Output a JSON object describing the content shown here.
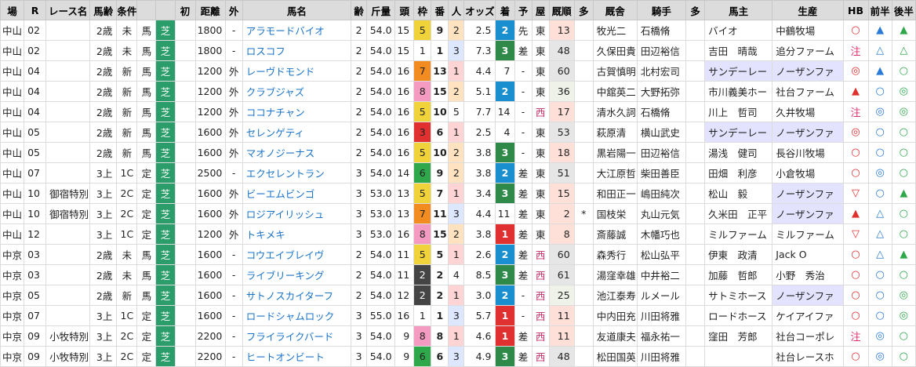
{
  "headers": [
    "場",
    "R",
    "レース名",
    "馬齢",
    "条件",
    "",
    "初",
    "距離",
    "外",
    "馬名",
    "齢",
    "斤量",
    "頭",
    "枠",
    "番",
    "人",
    "オッズ",
    "着",
    "予",
    "屋",
    "厩順",
    "多",
    "厩舎",
    "騎手",
    "多",
    "馬主",
    "生産",
    "HB",
    "前半",
    "後半"
  ],
  "rows": [
    [
      "中山",
      "02",
      "",
      "2歳",
      "未",
      "馬",
      "芝",
      "",
      "1800",
      "-",
      "アラモードバイオ",
      "2",
      "54.0",
      "15",
      "5",
      "9",
      "2",
      "2.5",
      "2",
      "先",
      "東",
      "13",
      "",
      "牧光二",
      "石橋脩",
      "",
      "バイオ",
      "中鶴牧場",
      "○",
      "▲",
      "▲"
    ],
    [
      "中山",
      "02",
      "",
      "2歳",
      "未",
      "馬",
      "芝",
      "",
      "1800",
      "-",
      "ロスコフ",
      "2",
      "54.0",
      "15",
      "1",
      "1",
      "3",
      "7.3",
      "3",
      "差",
      "東",
      "48",
      "",
      "久保田貴",
      "田辺裕信",
      "",
      "吉田　晴哉",
      "追分ファーム",
      "注",
      "△",
      "△"
    ],
    [
      "中山",
      "04",
      "",
      "2歳",
      "新",
      "馬",
      "芝",
      "",
      "1200",
      "外",
      "レーヴドモンド",
      "2",
      "54.0",
      "16",
      "7",
      "13",
      "1",
      "4.4",
      "7",
      "-",
      "東",
      "60",
      "",
      "古賀慎明",
      "北村宏司",
      "",
      "サンデーレー",
      "ノーザンファ",
      "◎",
      "▲",
      "○"
    ],
    [
      "中山",
      "04",
      "",
      "2歳",
      "新",
      "馬",
      "芝",
      "",
      "1200",
      "外",
      "クラブジャズ",
      "2",
      "54.0",
      "16",
      "8",
      "15",
      "2",
      "5.1",
      "2",
      "-",
      "東",
      "36",
      "",
      "中舘英二",
      "大野拓弥",
      "",
      "市川義美ホー",
      "社台ファーム",
      "▲",
      "○",
      "◎"
    ],
    [
      "中山",
      "04",
      "",
      "2歳",
      "新",
      "馬",
      "芝",
      "",
      "1200",
      "外",
      "ココナチャン",
      "2",
      "54.0",
      "16",
      "5",
      "10",
      "5",
      "7.7",
      "14",
      "-",
      "西",
      "17",
      "",
      "清水久詞",
      "石橋脩",
      "",
      "川上　哲司",
      "久井牧場",
      "注",
      "◎",
      "◎"
    ],
    [
      "中山",
      "05",
      "",
      "2歳",
      "新",
      "馬",
      "芝",
      "",
      "1600",
      "外",
      "セレンゲティ",
      "2",
      "54.0",
      "16",
      "3",
      "6",
      "1",
      "2.5",
      "4",
      "-",
      "東",
      "53",
      "",
      "萩原清",
      "横山武史",
      "",
      "サンデーレー",
      "ノーザンファ",
      "◎",
      "○",
      "○"
    ],
    [
      "中山",
      "05",
      "",
      "2歳",
      "新",
      "馬",
      "芝",
      "",
      "1600",
      "外",
      "マオノジーナス",
      "2",
      "54.0",
      "16",
      "5",
      "10",
      "2",
      "3.8",
      "3",
      "-",
      "東",
      "18",
      "",
      "黒岩陽一",
      "田辺裕信",
      "",
      "湯浅　健司",
      "長谷川牧場",
      "○",
      "○",
      "○"
    ],
    [
      "中山",
      "07",
      "",
      "3上",
      "1C",
      "定",
      "芝",
      "",
      "2500",
      "-",
      "エクセレントラン",
      "3",
      "54.0",
      "14",
      "6",
      "9",
      "2",
      "3.8",
      "2",
      "差",
      "東",
      "51",
      "",
      "大江原哲",
      "柴田善臣",
      "",
      "田畑　利彦",
      "小倉牧場",
      "○",
      "◎",
      "○"
    ],
    [
      "中山",
      "10",
      "御宿特別",
      "3上",
      "2C",
      "定",
      "芝",
      "",
      "1600",
      "外",
      "ビーエムビンゴ",
      "3",
      "53.0",
      "13",
      "5",
      "7",
      "1",
      "3.4",
      "3",
      "差",
      "東",
      "15",
      "",
      "和田正一",
      "嶋田純次",
      "",
      "松山　毅",
      "ノーザンファ",
      "▽",
      "○",
      "▲"
    ],
    [
      "中山",
      "10",
      "御宿特別",
      "3上",
      "2C",
      "定",
      "芝",
      "",
      "1600",
      "外",
      "ロジアイリッシュ",
      "3",
      "53.0",
      "13",
      "7",
      "11",
      "3",
      "4.4",
      "11",
      "差",
      "東",
      "2",
      "*",
      "国枝栄",
      "丸山元気",
      "",
      "久米田　正平",
      "ノーザンファ",
      "▲",
      "△",
      "○"
    ],
    [
      "中山",
      "12",
      "",
      "3上",
      "1C",
      "定",
      "芝",
      "",
      "1200",
      "外",
      "トキメキ",
      "3",
      "53.0",
      "16",
      "8",
      "15",
      "2",
      "3.8",
      "1",
      "差",
      "東",
      "8",
      "",
      "斎藤誠",
      "木幡巧也",
      "",
      "ミルファーム",
      "ミルファーム",
      "▽",
      "△",
      "○"
    ],
    [
      "中京",
      "03",
      "",
      "2歳",
      "未",
      "馬",
      "芝",
      "",
      "1600",
      "-",
      "コウエイブレイヴ",
      "2",
      "54.0",
      "11",
      "5",
      "5",
      "1",
      "2.6",
      "2",
      "差",
      "西",
      "60",
      "",
      "森秀行",
      "松山弘平",
      "",
      "伊東　政清",
      "Jack O",
      "○",
      "△",
      "▲"
    ],
    [
      "中京",
      "03",
      "",
      "2歳",
      "未",
      "馬",
      "芝",
      "",
      "1600",
      "-",
      "ライブリーキング",
      "2",
      "54.0",
      "11",
      "2",
      "2",
      "4",
      "8.5",
      "3",
      "差",
      "西",
      "61",
      "",
      "湯窪幸雄",
      "中井裕二",
      "",
      "加藤　哲郎",
      "小野　秀治",
      "○",
      "○",
      "○"
    ],
    [
      "中京",
      "05",
      "",
      "2歳",
      "新",
      "馬",
      "芝",
      "",
      "1600",
      "-",
      "サトノスカイターフ",
      "2",
      "54.0",
      "12",
      "2",
      "2",
      "1",
      "3.0",
      "2",
      "-",
      "西",
      "25",
      "",
      "池江泰寿",
      "ルメール",
      "",
      "サトミホース",
      "ノーザンファ",
      "○",
      "○",
      "◎"
    ],
    [
      "中京",
      "07",
      "",
      "3上",
      "1C",
      "定",
      "芝",
      "",
      "1600",
      "-",
      "ロードシャムロック",
      "3",
      "55.0",
      "16",
      "1",
      "1",
      "3",
      "5.7",
      "1",
      "-",
      "西",
      "11",
      "",
      "中内田充",
      "川田将雅",
      "",
      "ロードホース",
      "ケイアイファ",
      "○",
      "○",
      "◎"
    ],
    [
      "中京",
      "09",
      "小牧特別",
      "3上",
      "2C",
      "定",
      "芝",
      "",
      "2200",
      "-",
      "フライライクバード",
      "3",
      "54.0",
      "9",
      "8",
      "8",
      "1",
      "4.6",
      "1",
      "差",
      "西",
      "11",
      "",
      "友道康夫",
      "福永祐一",
      "",
      "窪田　芳郎",
      "社台コーポレ",
      "注",
      "◎",
      "○"
    ],
    [
      "中京",
      "09",
      "小牧特別",
      "3上",
      "2C",
      "定",
      "芝",
      "",
      "2200",
      "-",
      "ヒートオンビート",
      "3",
      "54.0",
      "9",
      "6",
      "6",
      "3",
      "4.9",
      "3",
      "差",
      "西",
      "48",
      "",
      "松田国英",
      "川田将雅",
      "",
      "",
      "社台レースホ",
      "○",
      "◎",
      "○"
    ]
  ],
  "colors": {
    "green": "#2a9d6a",
    "gate": {
      "1": "#ffffff",
      "2": "#444444",
      "3": "#e03030",
      "4": "#3a78d8",
      "5": "#f0d23a",
      "6": "#2ea84a",
      "7": "#f28b20",
      "8": "#f59ac0"
    },
    "pop1": "#ffd4d4",
    "pop2": "#ffe3c0",
    "pop3": "#dde7ff",
    "fin1": "#e03030",
    "fin2": "#1a8fd0",
    "fin3": "#2f8a4a",
    "horse": "#1a73c8",
    "purple": "#e3e3ff"
  }
}
